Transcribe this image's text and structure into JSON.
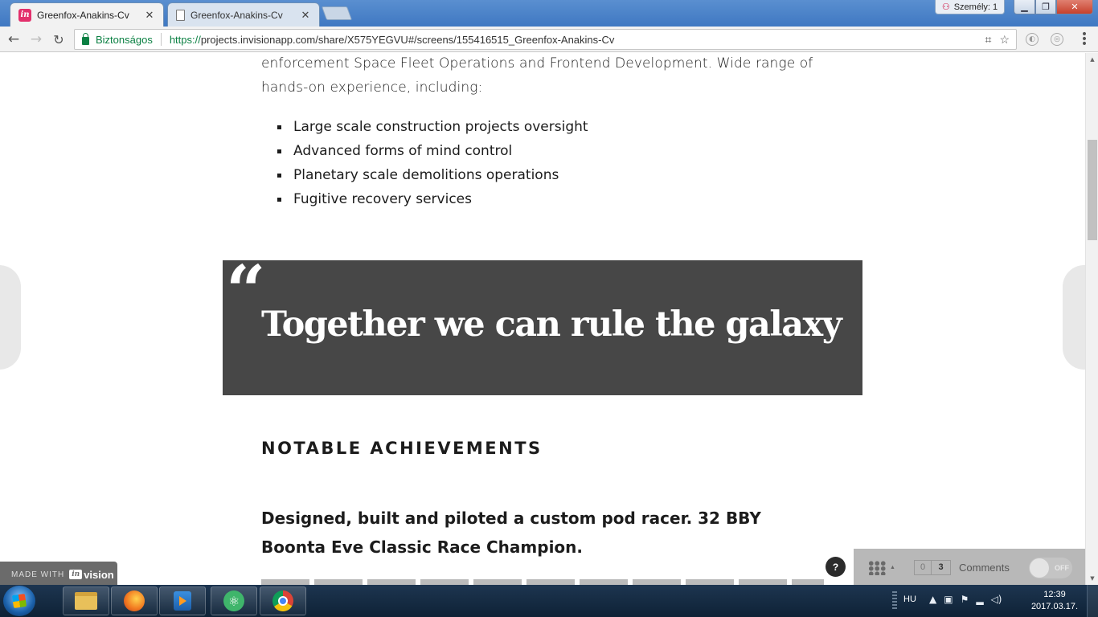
{
  "browser": {
    "tabs": [
      {
        "title": "Greenfox-Anakins-Cv",
        "close": "✕"
      },
      {
        "title": "Greenfox-Anakins-Cv",
        "close": "✕"
      }
    ],
    "profile_label": "Személy: 1",
    "secure_label": "Biztonságos",
    "url_protocol": "https://",
    "url_rest": "projects.invisionapp.com/share/X575YEGVU#/screens/155416515_Greenfox-Anakins-Cv"
  },
  "page": {
    "intro_text": "enforcement Space Fleet Operations and Frontend Development. Wide range of hands-on experience, including:",
    "bullets": [
      "Large scale construction projects oversight",
      "Advanced forms of mind control",
      "Planetary scale demolitions operations",
      "Fugitive recovery services"
    ],
    "quote_mark": "“",
    "quote": "Together we can rule the galaxy",
    "section_heading": "NOTABLE ACHIEVEMENTS",
    "achievement_title": "Designed, built and piloted a custom pod racer. 32 BBY Boonta Eve Classic Race Champion."
  },
  "invision": {
    "made_with": "MADE WITH",
    "logo_mark": "in",
    "logo_name": "vision",
    "help": "?",
    "count_unread": "0",
    "count_total": "3",
    "comments_label": "Comments",
    "toggle_label": "OFF"
  },
  "taskbar": {
    "language": "HU",
    "time": "12:39",
    "date": "2017.03.17."
  }
}
